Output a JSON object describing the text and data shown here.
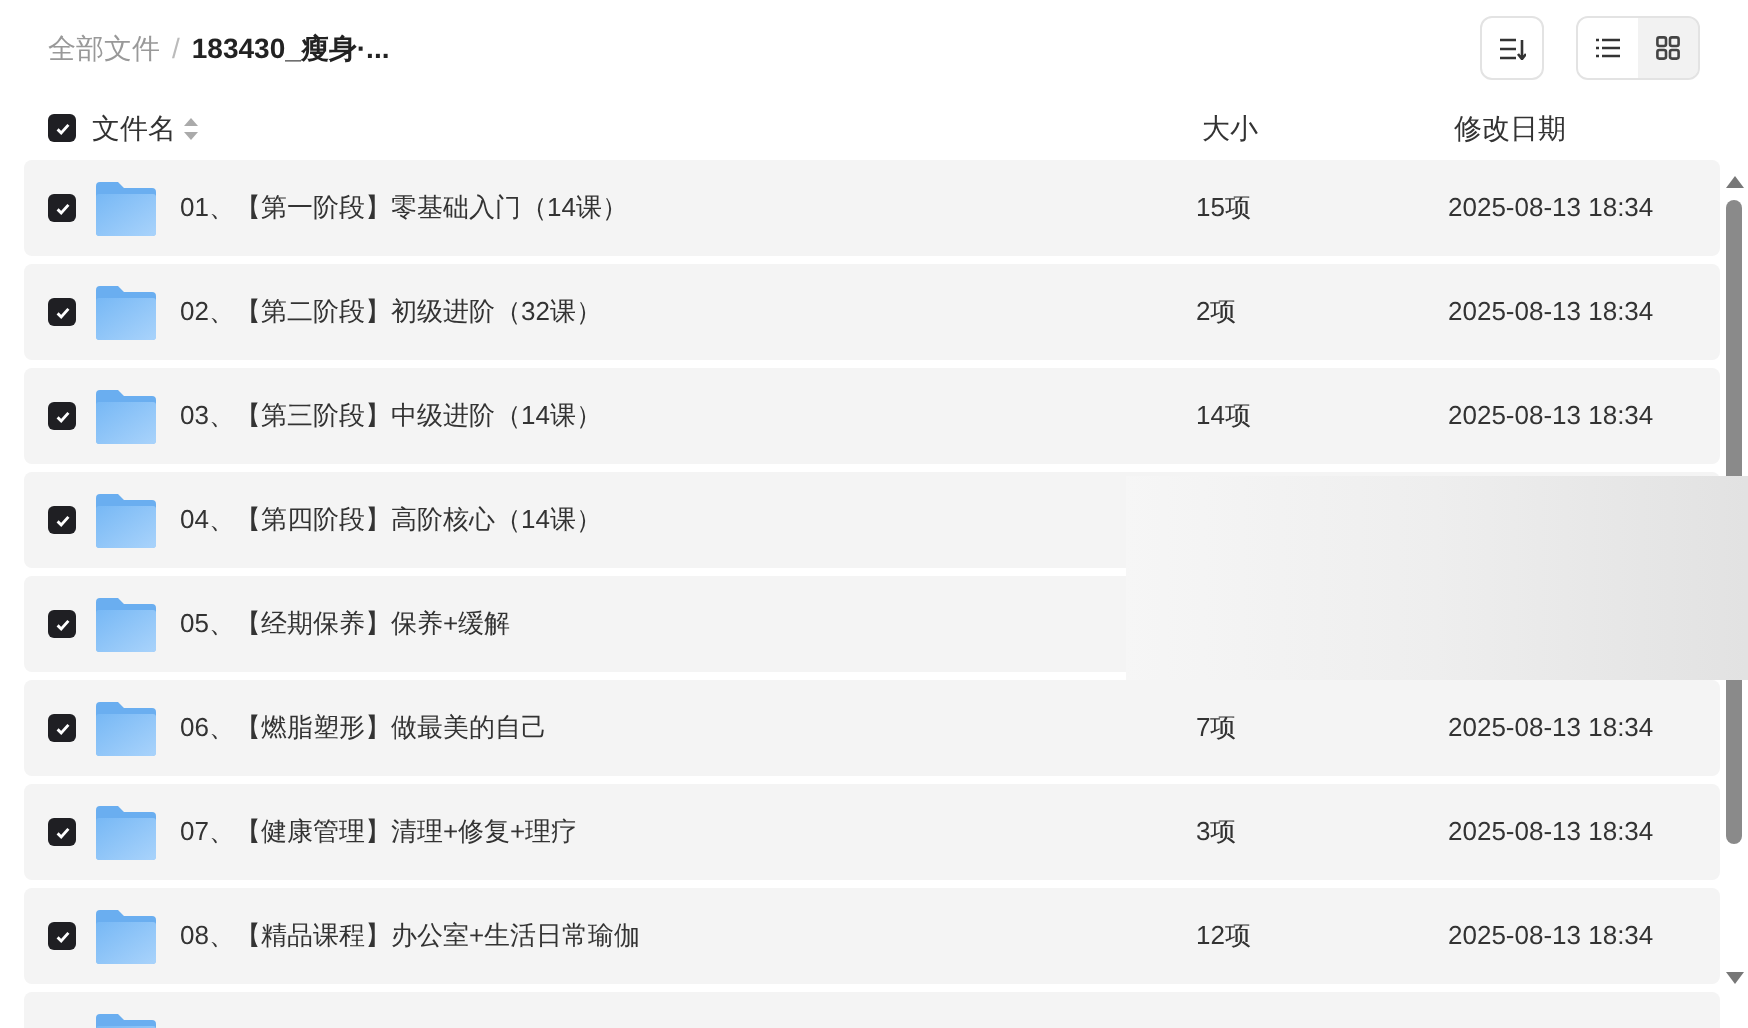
{
  "breadcrumb": [
    {
      "label": "全部文件",
      "current": false
    },
    {
      "label": "183430_瘦身·...",
      "current": true
    }
  ],
  "breadcrumb_separator": "/",
  "view_buttons": [
    {
      "kind": "list",
      "selected": true
    },
    {
      "kind": "grid",
      "selected": false
    }
  ],
  "header": {
    "all_checked": true,
    "columns": [
      "文件名",
      "大小",
      "修改日期"
    ]
  },
  "rows": [
    {
      "name": "01、【第一阶段】零基础入门（14课）",
      "size": "15项",
      "date": "2025-08-13 18:34",
      "checked": true
    },
    {
      "name": "02、【第二阶段】初级进阶（32课）",
      "size": "2项",
      "date": "2025-08-13 18:34",
      "checked": true
    },
    {
      "name": "03、【第三阶段】中级进阶（14课）",
      "size": "14项",
      "date": "2025-08-13 18:34",
      "checked": true
    },
    {
      "name": "04、【第四阶段】高阶核心（14课）",
      "checked": true
    },
    {
      "name": "05、【经期保养】保养+缓解",
      "checked": true
    },
    {
      "name": "06、【燃脂塑形】做最美的自己",
      "size": "7项",
      "date": "2025-08-13 18:34",
      "checked": true
    },
    {
      "name": "07、【健康管理】清理+修复+理疗",
      "size": "3项",
      "date": "2025-08-13 18:34",
      "checked": true
    },
    {
      "name": "08、【精品课程】办公室+生活日常瑜伽",
      "size": "12项",
      "date": "2025-08-13 18:34",
      "checked": true
    },
    {}
  ]
}
